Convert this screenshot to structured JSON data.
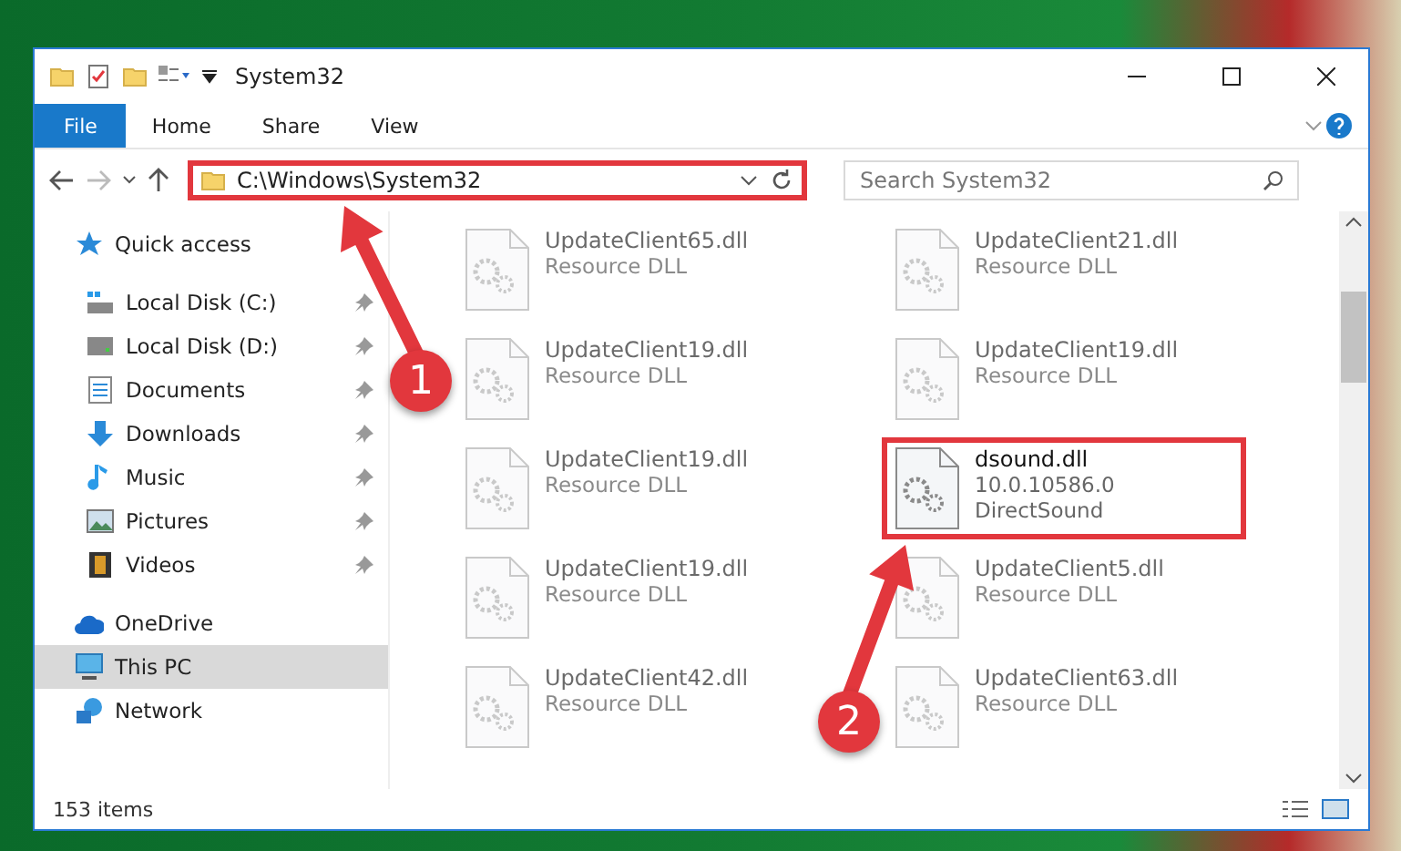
{
  "window": {
    "title": "System32"
  },
  "ribbon": {
    "tabs": [
      {
        "label": "File",
        "kind": "file"
      },
      {
        "label": "Home",
        "kind": "tab"
      },
      {
        "label": "Share",
        "kind": "tab"
      },
      {
        "label": "View",
        "kind": "tab"
      }
    ]
  },
  "address_bar": {
    "path": "C:\\Windows\\System32",
    "highlighted": true
  },
  "search": {
    "placeholder": "Search System32"
  },
  "sidebar": {
    "items": [
      {
        "label": "Quick access",
        "selected": false,
        "children": [
          {
            "label": "Local Disk (C:)",
            "pinned": true,
            "selected": false
          },
          {
            "label": "Local Disk (D:)",
            "pinned": true,
            "selected": false
          },
          {
            "label": "Documents",
            "pinned": true,
            "selected": false
          },
          {
            "label": "Downloads",
            "pinned": true,
            "selected": false
          },
          {
            "label": "Music",
            "pinned": true,
            "selected": false
          },
          {
            "label": "Pictures",
            "pinned": true,
            "selected": false
          },
          {
            "label": "Videos",
            "pinned": true,
            "selected": false
          }
        ]
      },
      {
        "label": "OneDrive",
        "selected": false
      },
      {
        "label": "This PC",
        "selected": true
      },
      {
        "label": "Network",
        "selected": false
      }
    ]
  },
  "files": [
    {
      "name": "UpdateClient65.dll",
      "lines": [
        "Resource DLL"
      ],
      "blurred": true,
      "highlighted": false
    },
    {
      "name": "UpdateClient21.dll",
      "lines": [
        "Resource DLL"
      ],
      "blurred": true,
      "highlighted": false
    },
    {
      "name": "UpdateClient19.dll",
      "lines": [
        "Resource DLL"
      ],
      "blurred": true,
      "highlighted": false
    },
    {
      "name": "UpdateClient19.dll",
      "lines": [
        "Resource DLL"
      ],
      "blurred": true,
      "highlighted": false
    },
    {
      "name": "UpdateClient19.dll",
      "lines": [
        "Resource DLL"
      ],
      "blurred": true,
      "highlighted": false
    },
    {
      "name": "dsound.dll",
      "lines": [
        "10.0.10586.0",
        "DirectSound"
      ],
      "blurred": false,
      "highlighted": true
    },
    {
      "name": "UpdateClient19.dll",
      "lines": [
        "Resource DLL"
      ],
      "blurred": true,
      "highlighted": false
    },
    {
      "name": "UpdateClient5.dll",
      "lines": [
        "Resource DLL"
      ],
      "blurred": true,
      "highlighted": false
    },
    {
      "name": "UpdateClient42.dll",
      "lines": [
        "Resource DLL"
      ],
      "blurred": true,
      "highlighted": false
    },
    {
      "name": "UpdateClient63.dll",
      "lines": [
        "Resource DLL"
      ],
      "blurred": true,
      "highlighted": false
    }
  ],
  "callouts": [
    {
      "number": "1"
    },
    {
      "number": "2"
    }
  ],
  "status_bar": {
    "count": "153 items"
  }
}
